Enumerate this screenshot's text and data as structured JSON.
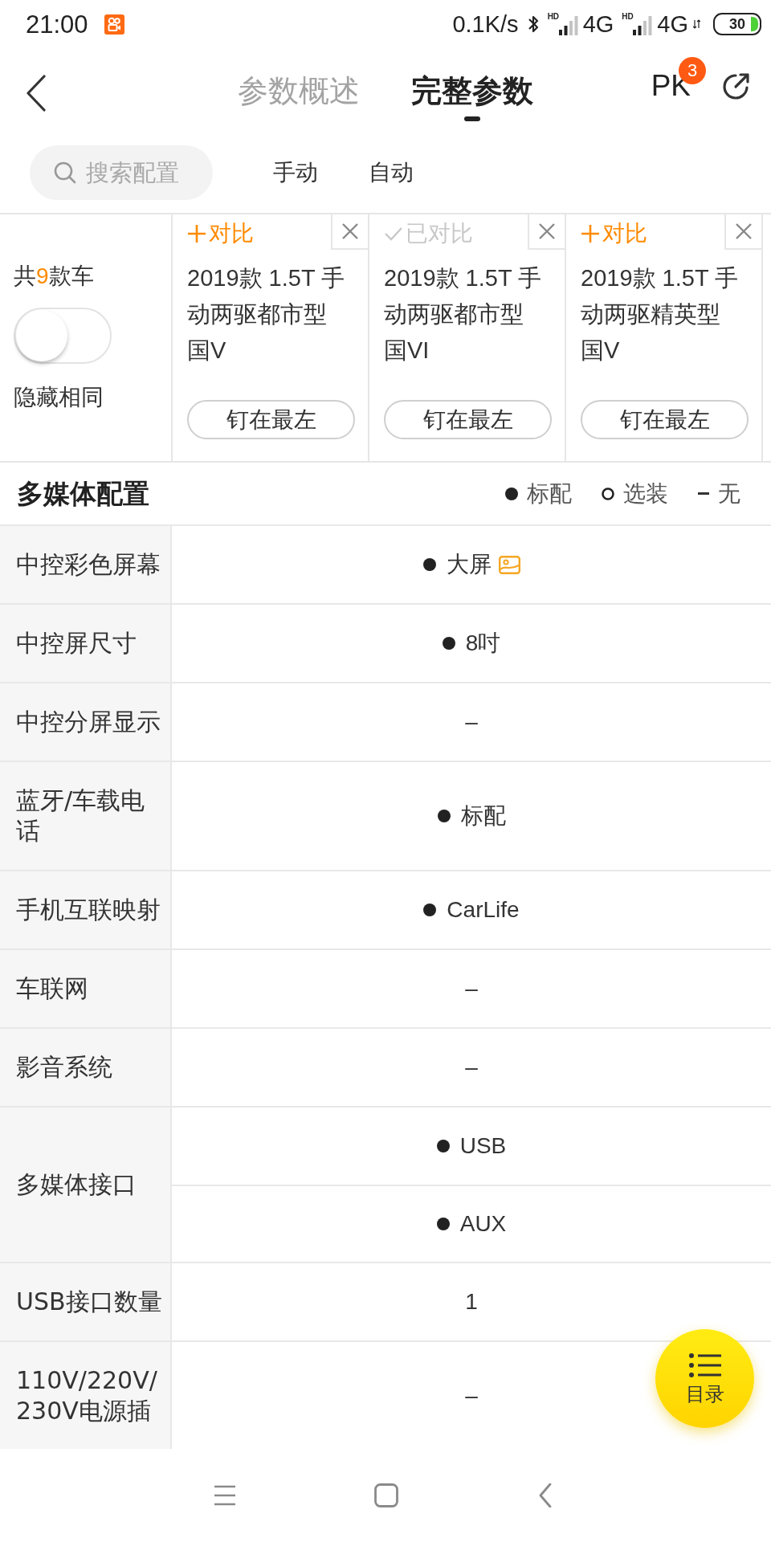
{
  "status_bar": {
    "time": "21:00",
    "net_speed": "0.1K/s",
    "signals": [
      {
        "badge": "HD",
        "network": "4G"
      },
      {
        "badge": "HD",
        "network": "4G"
      }
    ],
    "battery": "30"
  },
  "header": {
    "tabs": [
      {
        "label": "参数概述",
        "selected": false
      },
      {
        "label": "完整参数",
        "selected": true
      }
    ],
    "pk": {
      "label": "PK",
      "badge": "3"
    }
  },
  "filter": {
    "search": {
      "placeholder": "搜索配置"
    },
    "options": [
      {
        "label": "手动",
        "selected": false
      },
      {
        "label": "自动",
        "selected": false
      }
    ]
  },
  "cars_header": {
    "total": {
      "before": "共",
      "count": "9",
      "after": "款车"
    },
    "hide_same": {
      "label": "隐藏相同",
      "on": false
    }
  },
  "cars": [
    {
      "compare_label": "对比",
      "compared": false,
      "name": "2019款 1.5T 手动两驱都市型国V",
      "pin": "钉在最左"
    },
    {
      "compare_label": "已对比",
      "compared": true,
      "name": "2019款 1.5T 手动两驱都市型国VI",
      "pin": "钉在最左"
    },
    {
      "compare_label": "对比",
      "compared": false,
      "name": "2019款 1.5T 手动两驱精英型国V",
      "pin": "钉在最左"
    }
  ],
  "section": {
    "title": "多媒体配置",
    "legend": [
      {
        "kind": "standard",
        "label": "标配"
      },
      {
        "kind": "optional",
        "label": "选装"
      },
      {
        "kind": "none",
        "label": "无"
      }
    ]
  },
  "rows": [
    {
      "label": "中控彩色屏幕",
      "values": [
        {
          "text": "大屏",
          "kind": "standard",
          "picture": true
        }
      ]
    },
    {
      "label": "中控屏尺寸",
      "values": [
        {
          "text": "8吋",
          "kind": "standard"
        }
      ]
    },
    {
      "label": "中控分屏显示",
      "values": [
        {
          "text": "–",
          "kind": "none"
        }
      ]
    },
    {
      "label": "蓝牙/车载电话",
      "values": [
        {
          "text": "标配",
          "kind": "standard"
        }
      ]
    },
    {
      "label": "手机互联映射",
      "values": [
        {
          "text": "CarLife",
          "kind": "standard"
        }
      ]
    },
    {
      "label": "车联网",
      "values": [
        {
          "text": "–",
          "kind": "none"
        }
      ]
    },
    {
      "label": "影音系统",
      "values": [
        {
          "text": "–",
          "kind": "none"
        }
      ]
    },
    {
      "label": "多媒体接口",
      "values": [
        {
          "text": "USB",
          "kind": "standard"
        },
        {
          "text": "AUX",
          "kind": "standard"
        }
      ]
    },
    {
      "label": "USB接口数量",
      "values": [
        {
          "text": "1",
          "kind": "none"
        }
      ]
    },
    {
      "label": "110V/220V/230V电源插",
      "values": [
        {
          "text": "–",
          "kind": "none"
        }
      ]
    }
  ],
  "fab": {
    "label": "目录"
  }
}
